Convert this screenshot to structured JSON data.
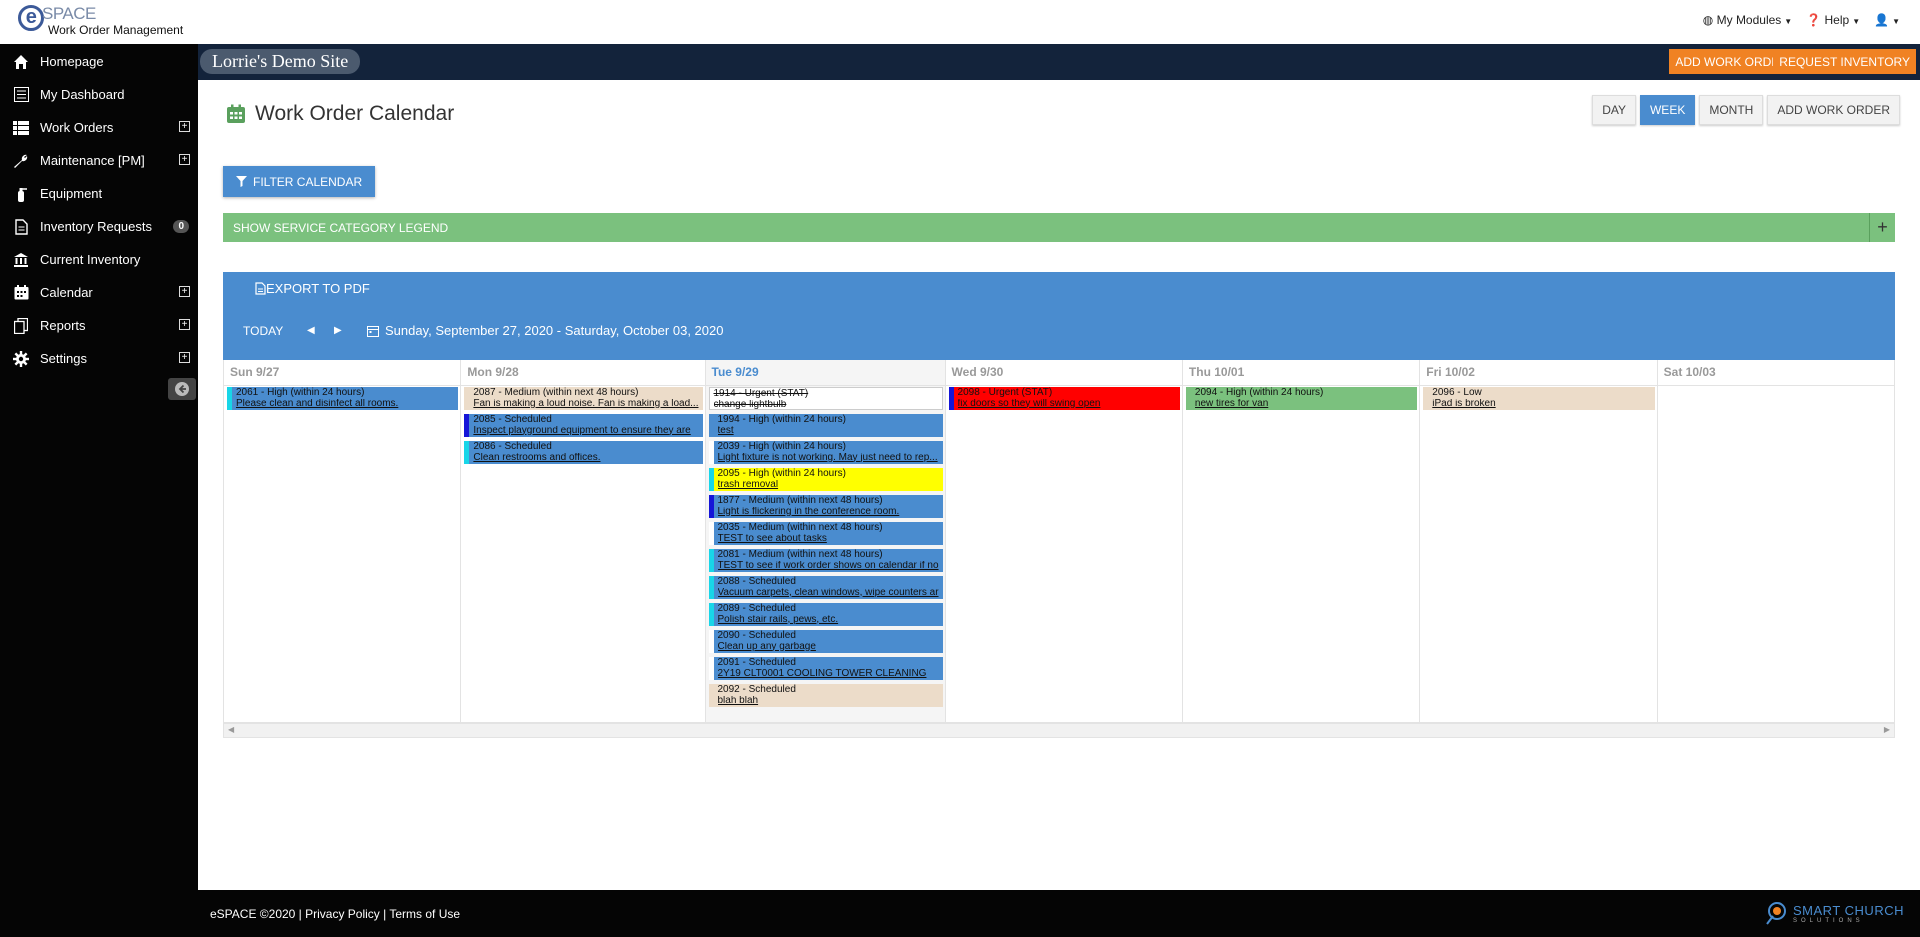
{
  "brand": {
    "name": "SPACE",
    "subtitle": "Work Order Management"
  },
  "top_nav": {
    "modules": "My Modules",
    "help": "Help"
  },
  "sidebar": {
    "items": [
      {
        "label": "Homepage",
        "icon": "home-icon",
        "expandable": false
      },
      {
        "label": "My Dashboard",
        "icon": "dashboard-icon",
        "expandable": false
      },
      {
        "label": "Work Orders",
        "icon": "table-icon",
        "expandable": true
      },
      {
        "label": "Maintenance [PM]",
        "icon": "wrench-icon",
        "expandable": true
      },
      {
        "label": "Equipment",
        "icon": "extinguisher-icon",
        "expandable": false
      },
      {
        "label": "Inventory Requests",
        "icon": "document-icon",
        "expandable": false,
        "badge": "0"
      },
      {
        "label": "Current Inventory",
        "icon": "bank-icon",
        "expandable": false
      },
      {
        "label": "Calendar",
        "icon": "calendar-icon",
        "expandable": true
      },
      {
        "label": "Reports",
        "icon": "copy-icon",
        "expandable": true
      },
      {
        "label": "Settings",
        "icon": "gear-icon",
        "expandable": true
      }
    ]
  },
  "sitebar": {
    "site_name": "Lorrie's Demo Site",
    "add_work_order": "ADD WORK ORDER",
    "request_inventory": "REQUEST INVENTORY"
  },
  "page": {
    "title": "Work Order Calendar",
    "views": {
      "day": "DAY",
      "week": "WEEK",
      "month": "MONTH",
      "add": "ADD WORK ORDER"
    },
    "filter": "FILTER CALENDAR",
    "legend": "SHOW SERVICE CATEGORY LEGEND",
    "export": "EXPORT TO PDF",
    "today": "TODAY",
    "range": "Sunday, September 27, 2020 - Saturday, October 03, 2020"
  },
  "calendar": {
    "days": [
      {
        "label": "Sun 9/27",
        "today": false,
        "events": [
          {
            "title": "2061 - High (within 24 hours)",
            "desc": "Please clean and disinfect all rooms.",
            "bg": "#4a8ccf",
            "bar": "#18d6e8"
          }
        ]
      },
      {
        "label": "Mon 9/28",
        "today": false,
        "events": [
          {
            "title": "2087 - Medium (within next 48 hours)",
            "desc": "Fan is making a loud noise. Fan is making a load...",
            "bg": "#ecdcc9",
            "bar": "#ecdcc9"
          },
          {
            "title": "2085 - Scheduled",
            "desc": "Inspect playground equipment to ensure they are",
            "bg": "#4a8ccf",
            "bar": "#1515d8"
          },
          {
            "title": "2086 - Scheduled",
            "desc": "Clean restrooms and offices.",
            "bg": "#4a8ccf",
            "bar": "#18d6e8"
          }
        ]
      },
      {
        "label": "Tue 9/29",
        "today": true,
        "events": [
          {
            "title": "1914 - Urgent (STAT)",
            "desc": "change lightbulb",
            "bg": "#ffffff",
            "bar": "#ffffff",
            "strike": true
          },
          {
            "title": "1994 - High (within 24 hours)",
            "desc": "test",
            "bg": "#4a8ccf",
            "bar": "#4a8ccf"
          },
          {
            "title": "2039 - High (within 24 hours)",
            "desc": "Light fixture is not working. May just need to rep...",
            "bg": "#4a8ccf",
            "bar": "#ffffff"
          },
          {
            "title": "2095 - High (within 24 hours)",
            "desc": "trash removal",
            "bg": "#ffff00",
            "bar": "#18d6e8"
          },
          {
            "title": "1877 - Medium (within next 48 hours)",
            "desc": "Light is flickering in the conference room.",
            "bg": "#4a8ccf",
            "bar": "#1515d8"
          },
          {
            "title": "2035 - Medium (within next 48 hours)",
            "desc": "TEST to see about tasks",
            "bg": "#4a8ccf",
            "bar": "#ffffff"
          },
          {
            "title": "2081 - Medium (within next 48 hours)",
            "desc": "TEST to see if work order shows on calendar if no",
            "bg": "#4a8ccf",
            "bar": "#18d6e8"
          },
          {
            "title": "2088 - Scheduled",
            "desc": "Vacuum carpets, clean windows, wipe counters ar",
            "bg": "#4a8ccf",
            "bar": "#18d6e8"
          },
          {
            "title": "2089 - Scheduled",
            "desc": "Polish stair rails, pews, etc.",
            "bg": "#4a8ccf",
            "bar": "#18d6e8"
          },
          {
            "title": "2090 - Scheduled",
            "desc": "Clean up any garbage",
            "bg": "#4a8ccf",
            "bar": "#ffffff"
          },
          {
            "title": "2091 - Scheduled",
            "desc": "2Y19 CLT0001 COOLING TOWER CLEANING",
            "bg": "#4a8ccf",
            "bar": "#ffffff"
          },
          {
            "title": "2092 - Scheduled",
            "desc": "blah blah",
            "bg": "#ecdcc9",
            "bar": "#ecdcc9"
          }
        ]
      },
      {
        "label": "Wed 9/30",
        "today": false,
        "events": [
          {
            "title": "2098 - Urgent (STAT)",
            "desc": "fix doors so they will swing open",
            "bg": "#ff0000",
            "bar": "#1515d8"
          }
        ]
      },
      {
        "label": "Thu 10/01",
        "today": false,
        "events": [
          {
            "title": "2094 - High (within 24 hours)",
            "desc": "new tires for van",
            "bg": "#7bc17e",
            "bar": "#7bc17e"
          }
        ]
      },
      {
        "label": "Fri 10/02",
        "today": false,
        "events": [
          {
            "title": "2096 - Low",
            "desc": "iPad is broken",
            "bg": "#ecdcc9",
            "bar": "#ecdcc9"
          }
        ]
      },
      {
        "label": "Sat 10/03",
        "today": false,
        "events": []
      }
    ]
  },
  "footer": {
    "copyright": "eSPACE ©2020 | Privacy Policy | Terms of Use",
    "logo_text": "SMART CHURCH",
    "logo_sub": "SOLUTIONS"
  }
}
